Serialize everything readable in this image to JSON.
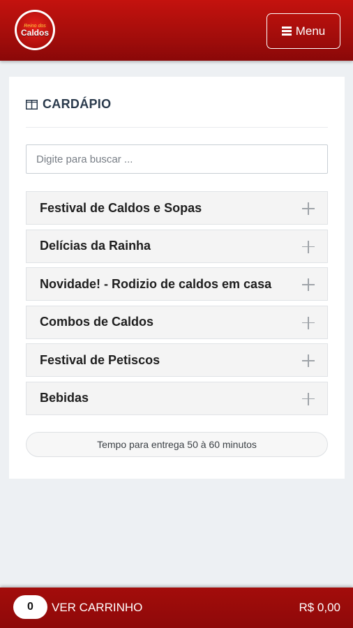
{
  "header": {
    "logo_small": "Reino dos",
    "logo_big": "Caldos",
    "menu_label": "Menu",
    "brand_color": "#b30f0c"
  },
  "menu": {
    "title": "CARDÁPIO",
    "search_placeholder": "Digite para buscar ...",
    "categories": [
      {
        "label": "Festival de Caldos e Sopas"
      },
      {
        "label": "Delícias da Rainha"
      },
      {
        "label": "Novidade! - Rodizio de caldos em casa"
      },
      {
        "label": "Combos de Caldos"
      },
      {
        "label": "Festival de Petiscos"
      },
      {
        "label": "Bebidas"
      }
    ],
    "delivery_text": "Tempo para entrega 50 à 60 minutos"
  },
  "cart": {
    "count": "0",
    "label": "VER CARRINHO",
    "total": "R$ 0,00"
  }
}
